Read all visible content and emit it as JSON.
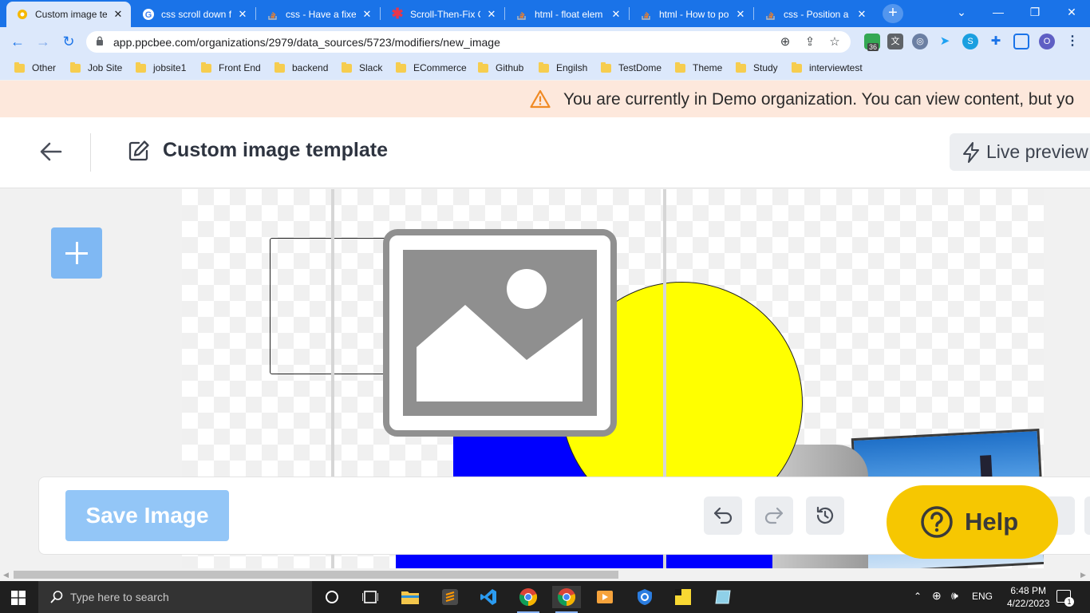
{
  "browser": {
    "tabs": [
      {
        "title": "Custom image te",
        "icon": "ppcbee-icon"
      },
      {
        "title": "css scroll down fi",
        "icon": "google-icon"
      },
      {
        "title": "css - Have a fixed",
        "icon": "stackoverflow-icon"
      },
      {
        "title": "Scroll-Then-Fix C",
        "icon": "asterisk-icon"
      },
      {
        "title": "html - float elem",
        "icon": "stackoverflow-icon"
      },
      {
        "title": "html - How to po",
        "icon": "stackoverflow-icon"
      },
      {
        "title": "css - Position a d",
        "icon": "stackoverflow-icon"
      }
    ],
    "url": "app.ppcbee.com/organizations/2979/data_sources/5723/modifiers/new_image",
    "extension_badge": "36",
    "profile_initial": "O",
    "bookmarks": [
      "Other",
      "Job Site",
      "jobsite1",
      "Front End",
      "backend",
      "Slack",
      "ECommerce",
      "Github",
      "Engilsh",
      "TestDome",
      "Theme",
      "Study",
      "interviewtest"
    ]
  },
  "app": {
    "banner_text": "You are currently in Demo organization. You can view content, but yo",
    "page_title": "Custom image template",
    "live_preview_label": "Live preview",
    "save_label": "Save Image",
    "help_label": "Help"
  },
  "taskbar": {
    "search_placeholder": "Type here to search",
    "language": "ENG",
    "time": "6:48 PM",
    "date": "4/22/2023",
    "notification_count": "1"
  },
  "colors": {
    "chrome_blue": "#1a73e8",
    "banner_bg": "#fde8dc",
    "add_button": "#7fb8f3",
    "save_button": "#93c6f7",
    "help_button": "#f6c701",
    "canvas_circle": "#ffff00",
    "canvas_rect": "#0000ff"
  }
}
